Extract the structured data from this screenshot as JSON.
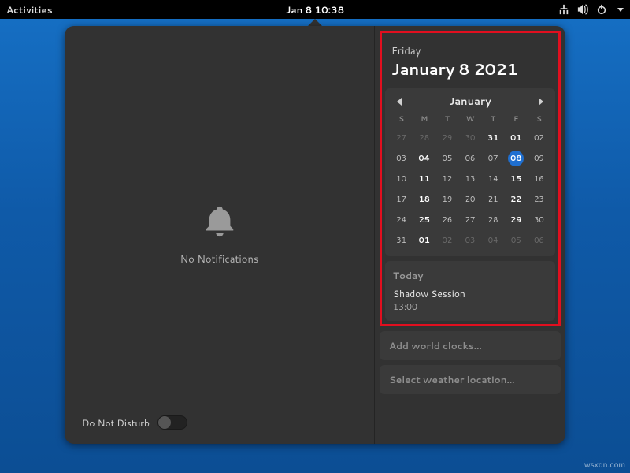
{
  "topbar": {
    "activities": "Activities",
    "clock": "Jan 8  10:38",
    "icons": [
      "network-icon",
      "volume-icon",
      "power-icon"
    ]
  },
  "notifications": {
    "empty_text": "No Notifications",
    "dnd_label": "Do Not Disturb",
    "dnd_on": false
  },
  "date_header": {
    "weekday": "Friday",
    "fulldate": "January 8 2021"
  },
  "calendar": {
    "month_label": "January",
    "dow": [
      "S",
      "M",
      "T",
      "W",
      "T",
      "F",
      "S"
    ],
    "weeks": [
      [
        {
          "n": "27",
          "other": true
        },
        {
          "n": "28",
          "other": true
        },
        {
          "n": "29",
          "other": true
        },
        {
          "n": "30",
          "other": true
        },
        {
          "n": "31",
          "other": true,
          "bold": true
        },
        {
          "n": "01",
          "bold": true
        },
        {
          "n": "02"
        }
      ],
      [
        {
          "n": "03"
        },
        {
          "n": "04",
          "bold": true
        },
        {
          "n": "05"
        },
        {
          "n": "06"
        },
        {
          "n": "07"
        },
        {
          "n": "08",
          "today": true
        },
        {
          "n": "09"
        }
      ],
      [
        {
          "n": "10"
        },
        {
          "n": "11",
          "bold": true
        },
        {
          "n": "12"
        },
        {
          "n": "13"
        },
        {
          "n": "14"
        },
        {
          "n": "15",
          "bold": true
        },
        {
          "n": "16"
        }
      ],
      [
        {
          "n": "17"
        },
        {
          "n": "18",
          "bold": true
        },
        {
          "n": "19"
        },
        {
          "n": "20"
        },
        {
          "n": "21"
        },
        {
          "n": "22",
          "bold": true
        },
        {
          "n": "23"
        }
      ],
      [
        {
          "n": "24"
        },
        {
          "n": "25",
          "bold": true
        },
        {
          "n": "26"
        },
        {
          "n": "27"
        },
        {
          "n": "28"
        },
        {
          "n": "29",
          "bold": true
        },
        {
          "n": "30"
        }
      ],
      [
        {
          "n": "31"
        },
        {
          "n": "01",
          "other": true,
          "bold": true
        },
        {
          "n": "02",
          "other": true
        },
        {
          "n": "03",
          "other": true
        },
        {
          "n": "04",
          "other": true
        },
        {
          "n": "05",
          "other": true
        },
        {
          "n": "06",
          "other": true
        }
      ]
    ]
  },
  "today_card": {
    "title": "Today",
    "event_name": "Shadow Session",
    "event_time": "13:00"
  },
  "buttons": {
    "world_clocks": "Add world clocks…",
    "weather": "Select weather location…"
  },
  "watermark": "wsxdn.com"
}
